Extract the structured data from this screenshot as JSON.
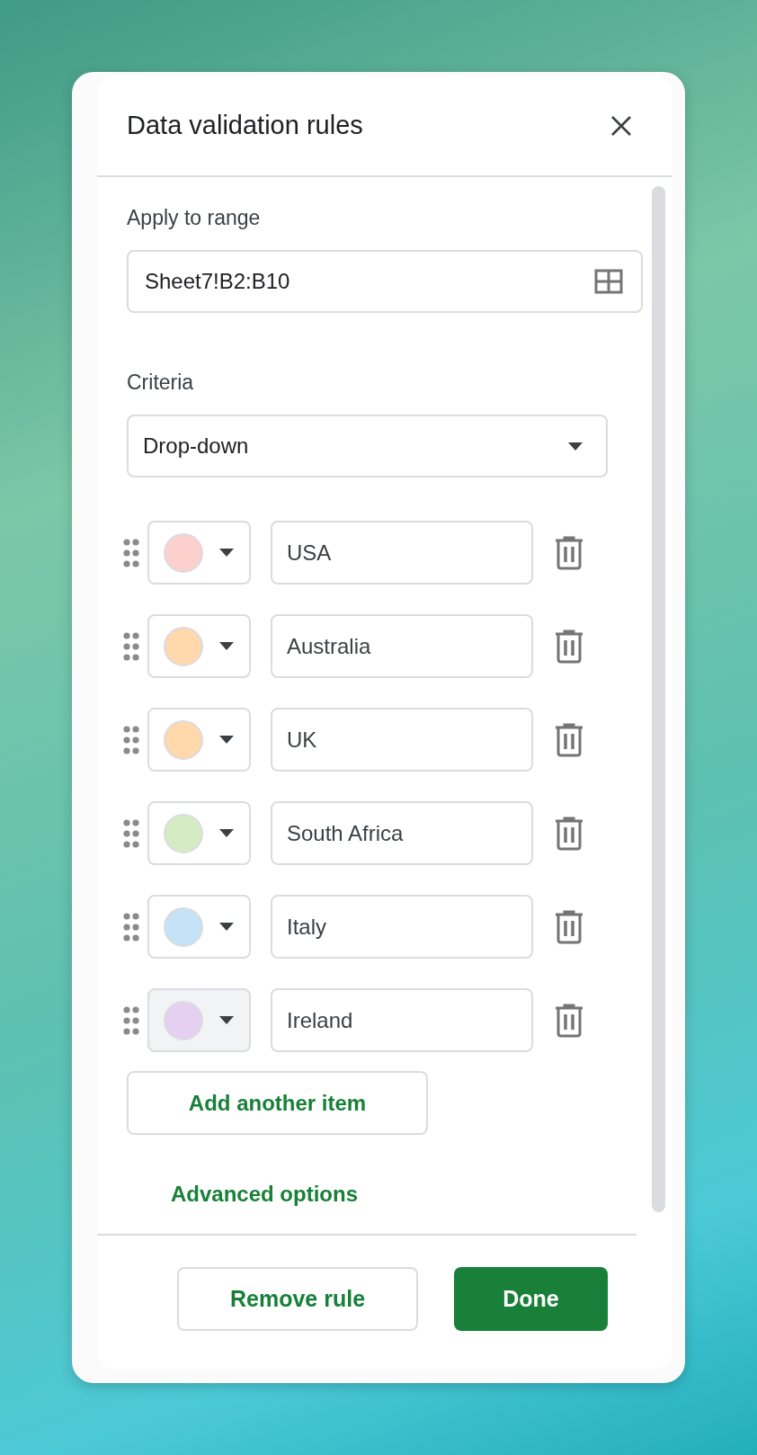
{
  "dialog": {
    "title": "Data validation rules"
  },
  "range": {
    "label": "Apply to range",
    "value": "Sheet7!B2:B10"
  },
  "criteria": {
    "label": "Criteria",
    "value": "Drop-down"
  },
  "items": [
    {
      "value": "USA",
      "color": "#fcd0cc",
      "active": false
    },
    {
      "value": "Australia",
      "color": "#ffd8ab",
      "active": false
    },
    {
      "value": "UK",
      "color": "#ffd8ab",
      "active": false
    },
    {
      "value": "South Africa",
      "color": "#d5ecc2",
      "active": false
    },
    {
      "value": "Italy",
      "color": "#c6e2f6",
      "active": false
    },
    {
      "value": "Ireland",
      "color": "#e5d0f2",
      "active": true
    }
  ],
  "add_button": "Add another item",
  "advanced_link": "Advanced options",
  "buttons": [
    {
      "label": "Remove rule",
      "kind": "secondary"
    },
    {
      "label": "Done",
      "kind": "primary"
    }
  ]
}
